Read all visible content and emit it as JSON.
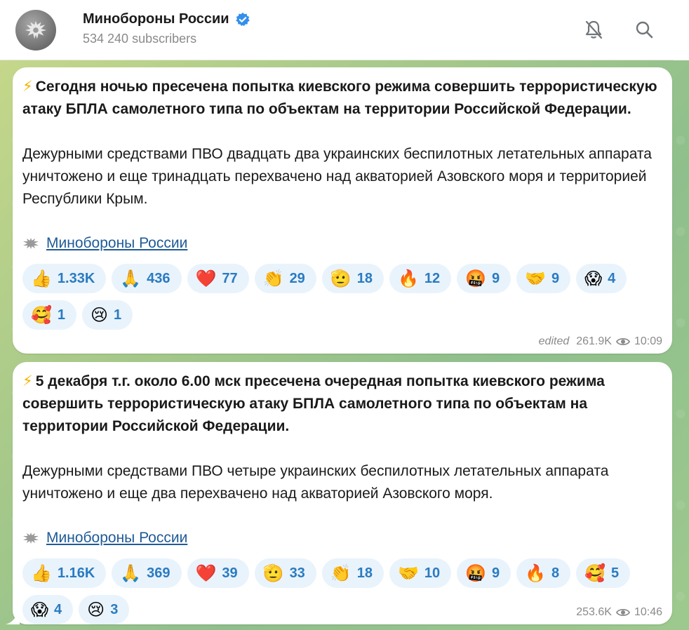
{
  "header": {
    "channel_name": "Минобороны России",
    "subscribers": "534 240 subscribers",
    "bell_icon": "bell-muted-icon",
    "search_icon": "search-icon"
  },
  "messages": [
    {
      "bolt": "⚡",
      "headline": "Сегодня ночью пресечена попытка киевского режима совершить террористическую атаку БПЛА самолетного типа по объектам на территории Российской Федерации.",
      "body": "Дежурными средствами ПВО двадцать два украинских беспилотных летательных аппарата уничтожено и еще тринадцать перехвачено над акваторией Азовского моря и территорией Республики Крым.",
      "signature": "Минобороны России",
      "reactions": [
        {
          "emoji": "👍",
          "count": "1.33K"
        },
        {
          "emoji": "🙏",
          "count": "436"
        },
        {
          "emoji": "❤️",
          "count": "77"
        },
        {
          "emoji": "👏",
          "count": "29"
        },
        {
          "emoji": "🫡",
          "count": "18"
        },
        {
          "emoji": "🔥",
          "count": "12"
        },
        {
          "emoji": "🤬",
          "count": "9"
        },
        {
          "emoji": "🤝",
          "count": "9"
        },
        {
          "emoji": "😱",
          "count": "4"
        },
        {
          "emoji": "🥰",
          "count": "1"
        },
        {
          "emoji": "😢",
          "count": "1"
        }
      ],
      "edited": "edited",
      "views": "261.9K",
      "time": "10:09"
    },
    {
      "bolt": "⚡",
      "headline": "5 декабря т.г. около 6.00 мск пресечена очередная попытка киевского режима совершить террористическую атаку БПЛА самолетного типа по объектам на территории Российской Федерации.",
      "body": "Дежурными средствами ПВО четыре украинских беспилотных летательных аппарата уничтожено и еще два перехвачено над акваторией Азовского моря.",
      "signature": "Минобороны России",
      "reactions": [
        {
          "emoji": "👍",
          "count": "1.16K"
        },
        {
          "emoji": "🙏",
          "count": "369"
        },
        {
          "emoji": "❤️",
          "count": "39"
        },
        {
          "emoji": "🫡",
          "count": "33"
        },
        {
          "emoji": "👏",
          "count": "18"
        },
        {
          "emoji": "🤝",
          "count": "10"
        },
        {
          "emoji": "🤬",
          "count": "9"
        },
        {
          "emoji": "🔥",
          "count": "8"
        },
        {
          "emoji": "🥰",
          "count": "5"
        },
        {
          "emoji": "😱",
          "count": "4"
        },
        {
          "emoji": "😢",
          "count": "3"
        }
      ],
      "edited": "",
      "views": "253.6K",
      "time": "10:46"
    }
  ],
  "colors": {
    "accent": "#2a7bc0",
    "link": "#1f5a96",
    "reaction_bg": "#e9f3fc",
    "verified": "#3390ec"
  }
}
